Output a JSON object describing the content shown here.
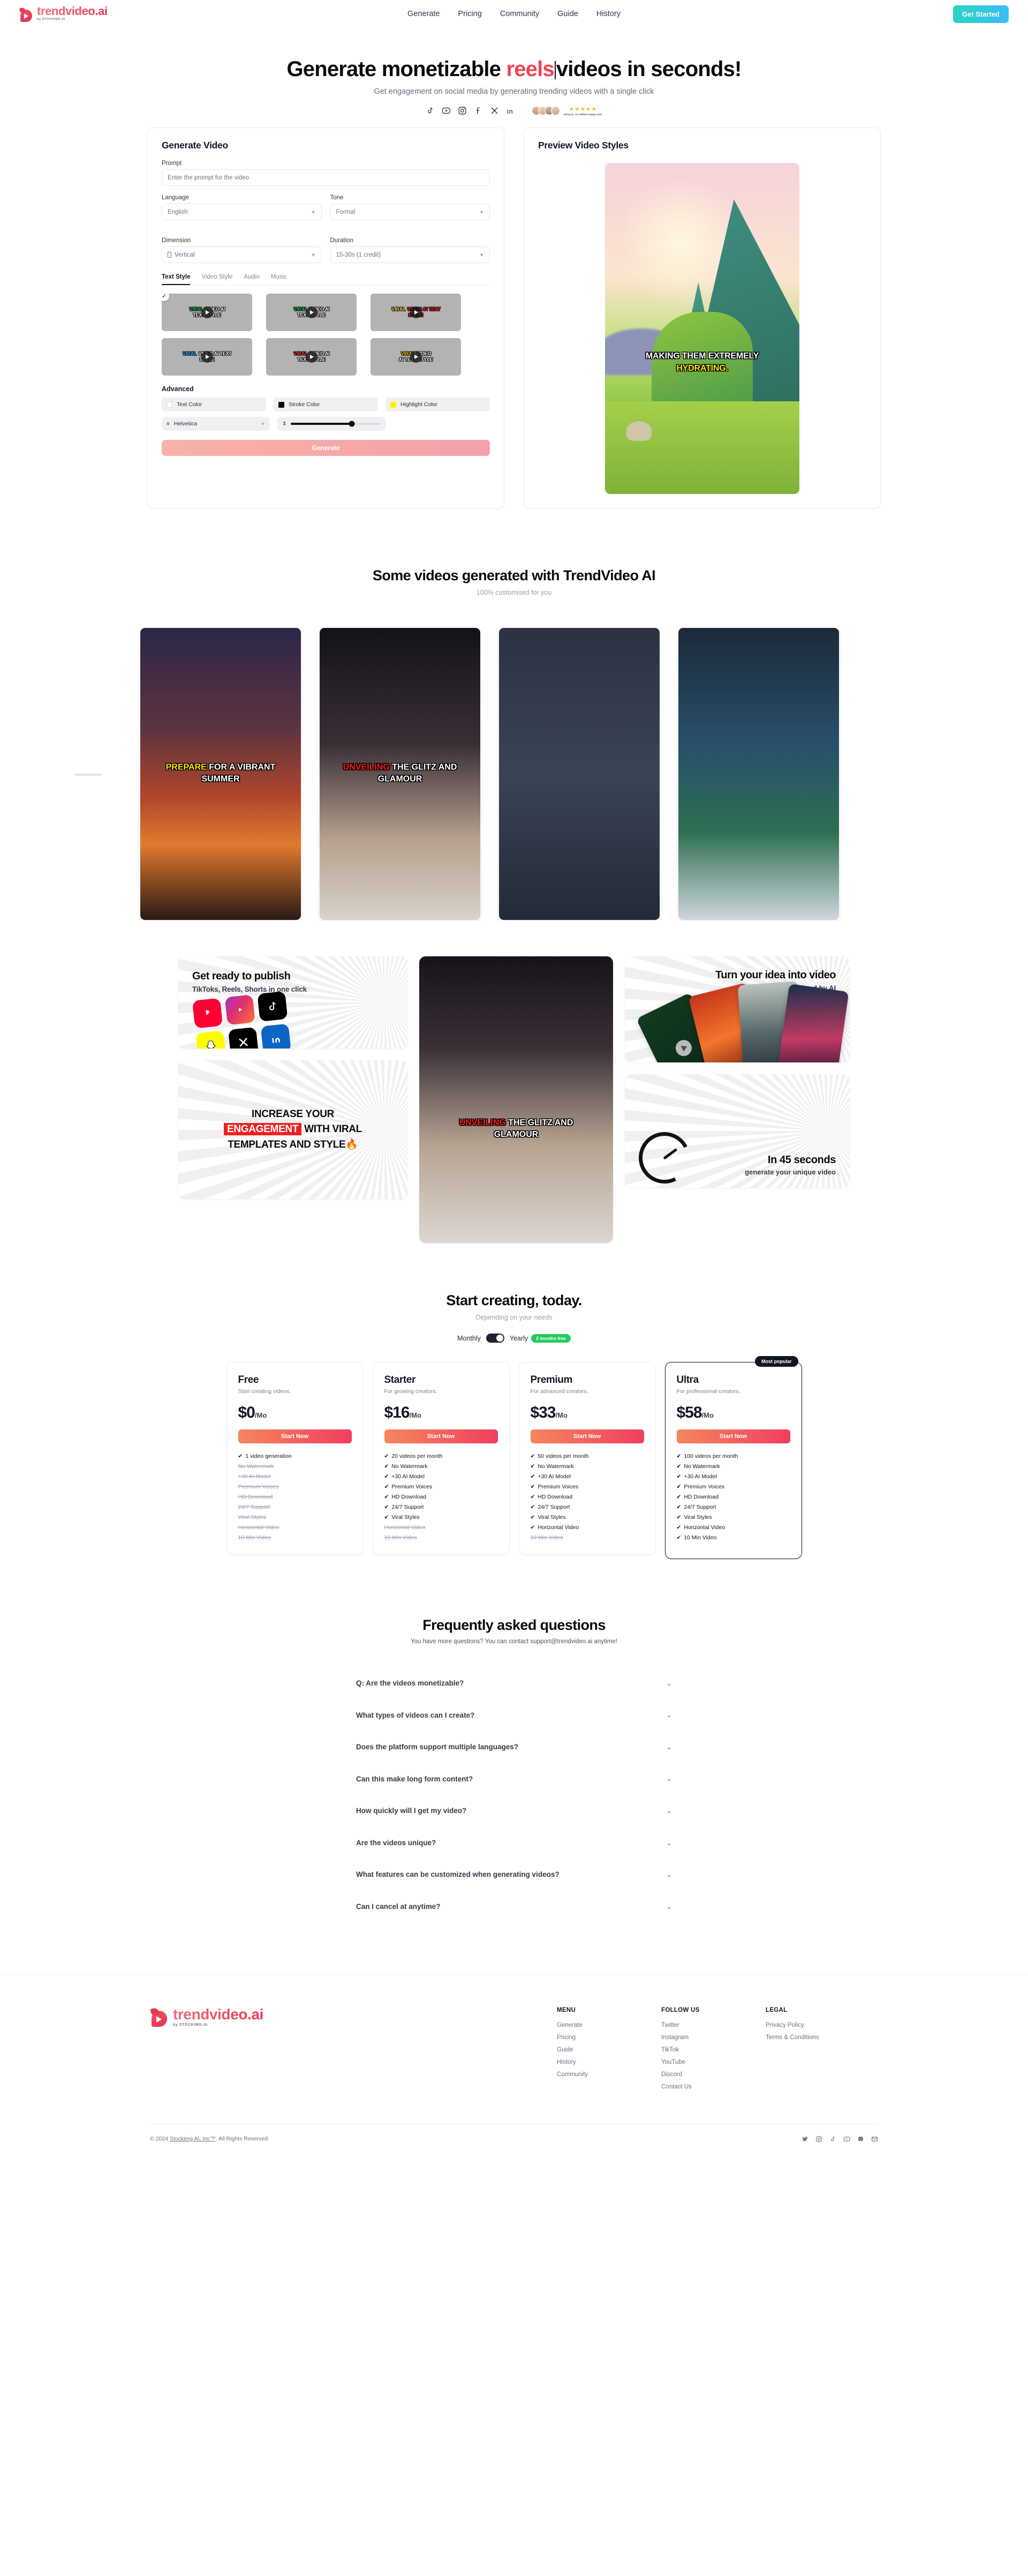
{
  "header": {
    "brand": "trendvideo.ai",
    "brand_sub": "by STOCKIMG.AI",
    "nav": [
      {
        "label": "Generate"
      },
      {
        "label": "Pricing"
      },
      {
        "label": "Community"
      },
      {
        "label": "Guide"
      },
      {
        "label": "History"
      }
    ],
    "cta": "Get Started"
  },
  "hero": {
    "title_before": "Generate monetizable ",
    "title_accent": "reels",
    "title_after": "videos in seconds!",
    "subtitle": "Get engagement on social media by generating trending videos with a single click",
    "social_icons": [
      "tiktok-icon",
      "youtube-icon",
      "instagram-icon",
      "facebook-icon",
      "x-icon",
      "linkedin-icon"
    ],
    "stars": "★★★★★",
    "rating_caption": "Using by +2.1 Million Happy User"
  },
  "generator": {
    "title": "Generate Video",
    "prompt_label": "Prompt",
    "prompt_placeholder": "Enter the prompt for the video",
    "prompt_value": "",
    "language_label": "Language",
    "language_value": "English",
    "tone_label": "Tone",
    "tone_value": "Formal",
    "dimension_label": "Dimension",
    "dimension_value": "Vertical",
    "duration_label": "Duration",
    "duration_value": "15-30s (1 credit)",
    "tabs": [
      {
        "label": "Text Style",
        "active": true
      },
      {
        "label": "Video Style",
        "active": false
      },
      {
        "label": "Audio",
        "active": false
      },
      {
        "label": "Music",
        "active": false
      }
    ],
    "styles": [
      {
        "line1_hl": "VIRAL",
        "line1": " VIDEO AI",
        "line2": "TEXT STYLE",
        "hl_color": "#22c55e",
        "selected": true
      },
      {
        "line1_hl": "VIRAL",
        "line1": " VIDEO AI",
        "line2": "TEXT STYLE",
        "hl_color": "#22c55e",
        "selected": false
      },
      {
        "line1_hl": "VIRAL",
        "line1": " VIDEO AI TEXT",
        "line2": "STYLE",
        "hl_color": "#fde047",
        "selected": false
      },
      {
        "line1_hl": "VIRAL",
        "line1": " VIDEO AI TEXT",
        "line2": "STYLE",
        "hl_color": "#38bdf8",
        "selected": false
      },
      {
        "line1_hl": "VIRAL",
        "line1": " VIDEO AI",
        "line2": "TEXT STYLE",
        "hl_color": "#ef4444",
        "selected": false
      },
      {
        "line1_hl": "VIRAL",
        "line1": " VIDEO",
        "line2": "AI TEXT STYLE",
        "hl_color": "#facc15",
        "selected": false
      }
    ],
    "advanced_title": "Advanced",
    "text_color_label": "Text Color",
    "text_color": "#ffffff",
    "stroke_color_label": "Stroke Color",
    "stroke_color": "#000000",
    "highlight_color_label": "Highlight Color",
    "highlight_color": "#ffee00",
    "font_value": "Helvetica",
    "size_value": "68",
    "generate_label": "Generate"
  },
  "preview": {
    "title": "Preview Video Styles",
    "caption_line1": "MAKING THEM EXTREMELY",
    "caption_line2": "HYDRATING."
  },
  "gallery": {
    "title": "Some videos generated with TrendVideo AI",
    "subtitle": "100% customised for you",
    "cards": [
      {
        "hl": "PREPARE",
        "rest": " FOR A VIBRANT",
        "line2": "SUMMER",
        "hl_color": "#ffe600"
      },
      {
        "hl": "UNVEILING",
        "rest": " THE GLITZ AND",
        "line2": "GLAMOUR",
        "hl_color": "#ff1b1b"
      },
      {
        "hl": "",
        "rest": "",
        "line2": "",
        "hl_color": "#ffe600"
      },
      {
        "hl": "",
        "rest": "",
        "line2": "",
        "hl_color": "#ffe600"
      }
    ]
  },
  "features": {
    "publish_title": "Get ready to publish",
    "publish_sub": "TikToks, Reels, Shorts in one click",
    "publish_icons": [
      "youtube-shorts-icon",
      "instagram-reels-icon",
      "tiktok-icon",
      "snapchat-icon",
      "x-icon",
      "linkedin-icon"
    ],
    "engagement_l1": "INCREASE YOUR",
    "engagement_hl": "ENGAGEMENT",
    "engagement_l2": " WITH VIRAL",
    "engagement_l3": "TEMPLATES AND STYLE🔥",
    "model_hl": "UNVEILING",
    "model_rest": " THE GLITZ AND",
    "model_line2": "GLAMOUR",
    "idea_title": "Turn your idea into video",
    "idea_sub": "in seconds powered by AI",
    "seconds_title": "In 45 seconds",
    "seconds_sub": "generate your unique video"
  },
  "pricing": {
    "title": "Start creating, today.",
    "subtitle": "Depending on your needs",
    "toggle_monthly": "Monthly",
    "toggle_yearly": "Yearly",
    "toggle_badge": "2 months free",
    "most_popular": "Most popular",
    "plans": [
      {
        "name": "Free",
        "desc": "Start creating videos.",
        "price": "$0",
        "per": "/Mo",
        "button": "Start Now",
        "features": [
          {
            "text": "1 video generation",
            "on": true
          },
          {
            "text": "No Watermark",
            "on": false
          },
          {
            "text": "+30 AI Model",
            "on": false
          },
          {
            "text": "Premium Voices",
            "on": false
          },
          {
            "text": "HD Download",
            "on": false
          },
          {
            "text": "24/7 Support",
            "on": false
          },
          {
            "text": "Viral Styles",
            "on": false
          },
          {
            "text": "Horizontal Video",
            "on": false
          },
          {
            "text": "10 Min Video",
            "on": false
          }
        ]
      },
      {
        "name": "Starter",
        "desc": "For growing creators.",
        "price": "$16",
        "per": "/Mo",
        "button": "Start Now",
        "features": [
          {
            "text": "20 videos per month",
            "on": true
          },
          {
            "text": "No Watermark",
            "on": true
          },
          {
            "text": "+30 AI Model",
            "on": true
          },
          {
            "text": "Premium Voices",
            "on": true
          },
          {
            "text": "HD Download",
            "on": true
          },
          {
            "text": "24/7 Support",
            "on": true
          },
          {
            "text": "Viral Styles",
            "on": true
          },
          {
            "text": "Horizontal Video",
            "on": false
          },
          {
            "text": "10 Min Video",
            "on": false
          }
        ]
      },
      {
        "name": "Premium",
        "desc": "For advanced creators.",
        "price": "$33",
        "per": "/Mo",
        "button": "Start Now",
        "features": [
          {
            "text": "50 videos per month",
            "on": true
          },
          {
            "text": "No Watermark",
            "on": true
          },
          {
            "text": "+30 AI Model",
            "on": true
          },
          {
            "text": "Premium Voices",
            "on": true
          },
          {
            "text": "HD Download",
            "on": true
          },
          {
            "text": "24/7 Support",
            "on": true
          },
          {
            "text": "Viral Styles",
            "on": true
          },
          {
            "text": "Horizontal Video",
            "on": true
          },
          {
            "text": "10 Min Video",
            "on": false
          }
        ]
      },
      {
        "name": "Ultra",
        "desc": "For professional creators.",
        "price": "$58",
        "per": "/Mo",
        "button": "Start Now",
        "featured": true,
        "features": [
          {
            "text": "100 videos per month",
            "on": true
          },
          {
            "text": "No Watermark",
            "on": true
          },
          {
            "text": "+30 AI Model",
            "on": true
          },
          {
            "text": "Premium Voices",
            "on": true
          },
          {
            "text": "HD Download",
            "on": true
          },
          {
            "text": "24/7 Support",
            "on": true
          },
          {
            "text": "Viral Styles",
            "on": true
          },
          {
            "text": "Horizontal Video",
            "on": true
          },
          {
            "text": "10 Min Video",
            "on": true
          }
        ]
      }
    ]
  },
  "faq": {
    "title": "Frequently asked questions",
    "subtitle": "You have more questions? You can contact support@trendvideo.ai anytime!",
    "items": [
      {
        "q": "Q: Are the videos monetizable?"
      },
      {
        "q": "What types of videos can I create?"
      },
      {
        "q": "Does the platform support multiple languages?"
      },
      {
        "q": "Can this make long form content?"
      },
      {
        "q": "How quickly will I get my video?"
      },
      {
        "q": "Are the videos unique?"
      },
      {
        "q": "What features can be customized when generating videos?"
      },
      {
        "q": "Can I cancel at anytime?"
      }
    ]
  },
  "footer": {
    "brand": "trendvideo.ai",
    "brand_sub": "by STOCKIMG.AI",
    "columns": [
      {
        "title": "MENU",
        "links": [
          "Generate",
          "Pricing",
          "Guide",
          "History",
          "Community"
        ]
      },
      {
        "title": "FOLLOW US",
        "links": [
          "Twitter",
          "Instagram",
          "TikTok",
          "YouTube",
          "Discord",
          "Contact Us"
        ]
      },
      {
        "title": "LEGAL",
        "links": [
          "Privacy Policy",
          "Terms & Conditions"
        ]
      }
    ],
    "copyright_pre": "© 2024 ",
    "copyright_link": "Stockimg AI, Inc™",
    "copyright_post": ". All Rights Reserved.",
    "social_icons": [
      "twitter-icon",
      "instagram-icon",
      "tiktok-icon",
      "youtube-icon",
      "discord-icon",
      "mail-icon"
    ]
  }
}
